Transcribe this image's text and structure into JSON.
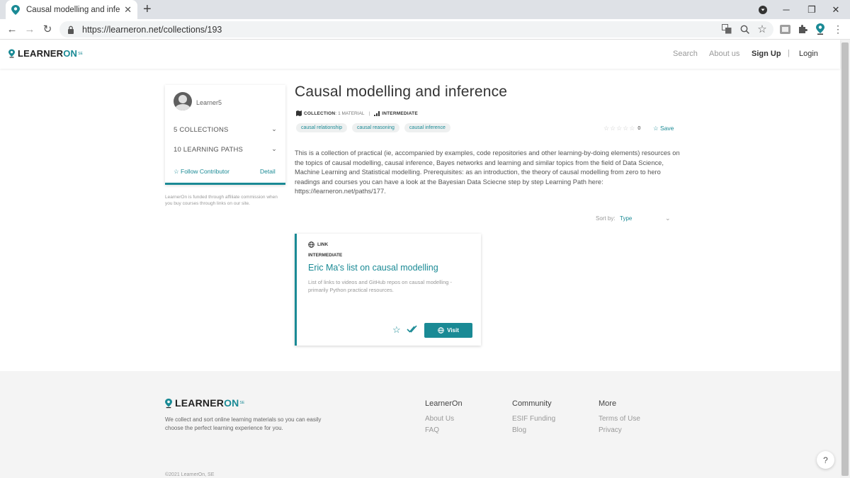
{
  "browser": {
    "tab_title": "Causal modelling and inference |",
    "url": "https://learneron.net/collections/193"
  },
  "site": {
    "logo_text": "LEARNER",
    "logo_on": "ON",
    "logo_sup": "SE",
    "nav": {
      "search": "Search",
      "about": "About us",
      "signup": "Sign Up",
      "separator": "|",
      "login": "Login"
    }
  },
  "sidebar": {
    "username": "Learner5",
    "collections_label": "5 COLLECTIONS",
    "paths_label": "10 LEARNING PATHS",
    "follow_label": "Follow Contributor",
    "detail_label": "Detail",
    "affiliate_note": "LearnerOn is funded through affiliate commission when you buy courses through links on our site."
  },
  "collection": {
    "title": "Causal modelling and inference",
    "type_label": "COLLECTION",
    "material_count": "1 MATERIAL",
    "level_label": "INTERMEDIATE",
    "tags": [
      "causal relationship",
      "causal reasoning",
      "causal inference"
    ],
    "rating_count": "0",
    "save_label": "Save",
    "description": "This is a collection of practical (ie, accompanied by examples, code repositories and other learning-by-doing elements) resources on the topics of causal modelling, causal inference, Bayes networks and learning and similar topics from the field of Data Science, Machine Learning and Statistical modelling. Prerequisites: as an introduction, the theory of causal modelling from zero to hero readings and courses you can have a look at the Bayesian Data Sciecne step by step Learning Path here: https://learneron.net/paths/177.",
    "sort_label": "Sort by:",
    "sort_value": "Type"
  },
  "material": {
    "type_label": "LINK",
    "level_label": "INTERMEDIATE",
    "title": "Eric Ma's list on causal modelling",
    "description": "List of links to videos and GitHub repos on causal modelling - primarily Python practical resources.",
    "visit_label": "Visit"
  },
  "footer": {
    "tagline": "We collect and sort online learning materials so you can easily choose the perfect learning experience for you.",
    "col1_heading": "LearnerOn",
    "col1_links": [
      "About Us",
      "FAQ"
    ],
    "col2_heading": "Community",
    "col2_links": [
      "ESIF Funding",
      "Blog"
    ],
    "col3_heading": "More",
    "col3_links": [
      "Terms of Use",
      "Privacy"
    ],
    "copyright": "©2021 LearnerOn, SE",
    "help_label": "?"
  },
  "colors": {
    "accent": "#1a8a95",
    "footer_bg": "#f4f4f4"
  },
  "icons": {
    "favicon": "learneron-pin-icon",
    "globe": "globe-icon",
    "check": "double-check-icon"
  }
}
